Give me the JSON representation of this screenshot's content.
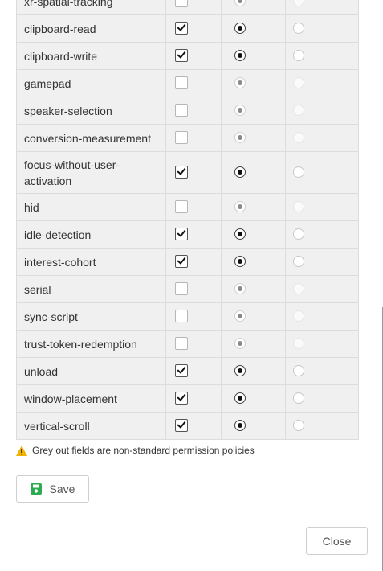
{
  "rows": [
    {
      "name": "xr-spatial-tracking",
      "checked": false,
      "standard": false
    },
    {
      "name": "clipboard-read",
      "checked": true,
      "standard": true
    },
    {
      "name": "clipboard-write",
      "checked": true,
      "standard": true
    },
    {
      "name": "gamepad",
      "checked": false,
      "standard": false
    },
    {
      "name": "speaker-selection",
      "checked": false,
      "standard": false
    },
    {
      "name": "conversion-measurement",
      "checked": false,
      "standard": false
    },
    {
      "name": "focus-without-user-activation",
      "checked": true,
      "standard": true
    },
    {
      "name": "hid",
      "checked": false,
      "standard": false
    },
    {
      "name": "idle-detection",
      "checked": true,
      "standard": true
    },
    {
      "name": "interest-cohort",
      "checked": true,
      "standard": true
    },
    {
      "name": "serial",
      "checked": false,
      "standard": false
    },
    {
      "name": "sync-script",
      "checked": false,
      "standard": false
    },
    {
      "name": "trust-token-redemption",
      "checked": false,
      "standard": false
    },
    {
      "name": "unload",
      "checked": true,
      "standard": true
    },
    {
      "name": "window-placement",
      "checked": true,
      "standard": true
    },
    {
      "name": "vertical-scroll",
      "checked": true,
      "standard": true
    }
  ],
  "note": "Grey out fields are non-standard permission policies",
  "save_label": "Save",
  "close_label": "Close",
  "colors": {
    "warning": "#f0b400",
    "save_icon": "#2eaa50"
  }
}
